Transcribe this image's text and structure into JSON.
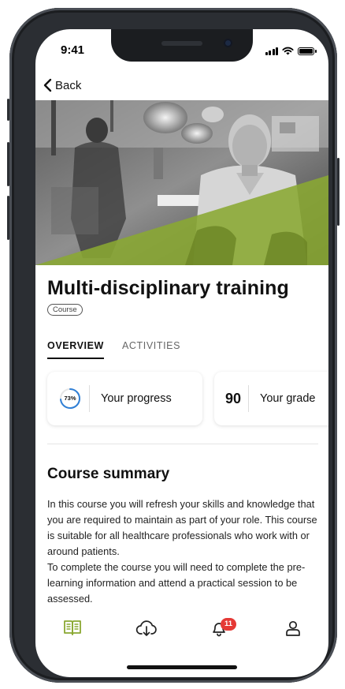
{
  "status_bar": {
    "time": "9:41",
    "icons": [
      "signal-icon",
      "wifi-icon",
      "battery-icon"
    ]
  },
  "header": {
    "back_label": "Back",
    "back_icon": "chevron-left-icon"
  },
  "course": {
    "title": "Multi-disciplinary training",
    "type_badge": "Course"
  },
  "tabs": [
    {
      "label": "OVERVIEW",
      "active": true
    },
    {
      "label": "ACTIVITIES",
      "active": false
    }
  ],
  "stats": {
    "progress": {
      "value": "73%",
      "fraction": 0.73,
      "label": "Your progress"
    },
    "grade": {
      "value": "90",
      "label": "Your grade"
    }
  },
  "summary": {
    "title": "Course summary",
    "paragraph_1": "In this course you will refresh your skills and knowledge that you are required to maintain as part of your role. This course is suitable for all healthcare professionals who work with or around patients.",
    "paragraph_2": "To complete the course you will need to complete the pre-learning information and attend a practical session to be assessed."
  },
  "bottom_nav": {
    "items": [
      {
        "icon": "book-icon",
        "active": true
      },
      {
        "icon": "cloud-download-icon",
        "active": false
      },
      {
        "icon": "bell-icon",
        "active": false,
        "badge": "11"
      },
      {
        "icon": "user-icon",
        "active": false
      }
    ]
  },
  "colors": {
    "accent": "#8aa832",
    "progress_ring": "#2f7fd6",
    "badge": "#e53935"
  }
}
